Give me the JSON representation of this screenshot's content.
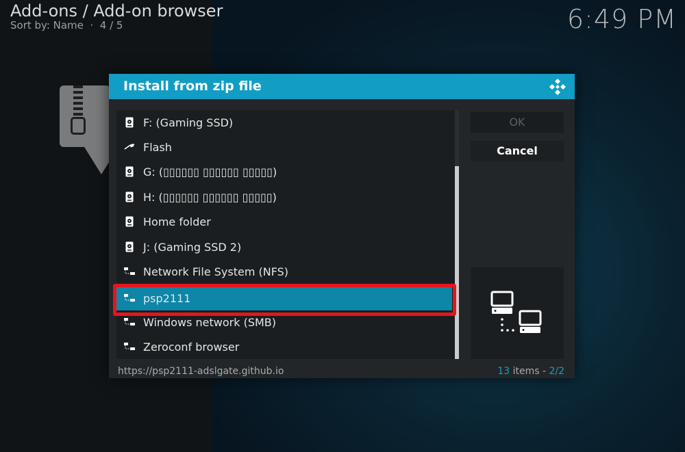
{
  "header": {
    "breadcrumb": "Add-ons / Add-on browser",
    "sort_label": "Sort by: Name",
    "position": "4 / 5",
    "clock": "6:49 PM"
  },
  "dialog": {
    "title": "Install from zip file",
    "buttons": {
      "ok": "OK",
      "cancel": "Cancel"
    },
    "items": [
      {
        "label": "F: (Gaming SSD)",
        "icon": "hard-drive-icon"
      },
      {
        "label": "Flash",
        "icon": "usb-icon"
      },
      {
        "label": "G: (▯▯▯▯▯▯ ▯▯▯▯▯▯ ▯▯▯▯▯)",
        "icon": "hard-drive-icon"
      },
      {
        "label": "H: (▯▯▯▯▯▯ ▯▯▯▯▯▯ ▯▯▯▯▯)",
        "icon": "hard-drive-icon"
      },
      {
        "label": "Home folder",
        "icon": "hard-drive-icon"
      },
      {
        "label": "J: (Gaming SSD 2)",
        "icon": "hard-drive-icon"
      },
      {
        "label": "Network File System (NFS)",
        "icon": "network-icon"
      },
      {
        "label": "psp2111",
        "icon": "network-icon",
        "selected": true
      },
      {
        "label": "Windows network (SMB)",
        "icon": "network-icon"
      },
      {
        "label": "Zeroconf browser",
        "icon": "network-icon"
      }
    ],
    "footer": {
      "path": "https://psp2111-adslgate.github.io",
      "count": "13",
      "count_suffix": " items - ",
      "page": "2/2"
    },
    "accent_color": "#12a0c6",
    "highlight_color": "#e8141b"
  }
}
